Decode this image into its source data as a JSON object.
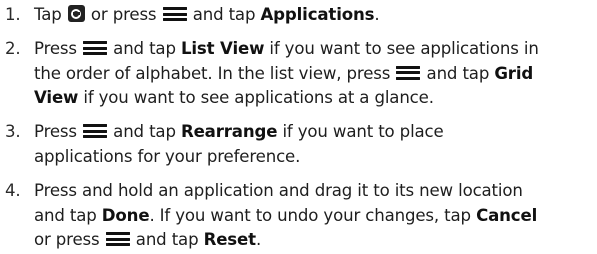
{
  "steps": [
    {
      "number": "1.",
      "t1": "Tap",
      "t2": "or press",
      "t3": "and tap",
      "b1": "Applications",
      "t4": "."
    },
    {
      "number": "2.",
      "l1": {
        "t1": "Press",
        "t2": "and tap",
        "b1": "List View",
        "t3": "if you want to see applications in"
      },
      "l2": {
        "t1": "the order of alphabet. In the list view, press",
        "t2": "and tap",
        "b1": "Grid"
      },
      "l3": {
        "b1": "View",
        "t1": "if you want to see applications at a glance."
      }
    },
    {
      "number": "3.",
      "l1": {
        "t1": "Press",
        "t2": "and tap",
        "b1": "Rearrange",
        "t3": "if you want to place"
      },
      "l2": {
        "t1": "applications for your preference."
      }
    },
    {
      "number": "4.",
      "l1": {
        "t1": "Press and hold an application and drag it to its new location"
      },
      "l2": {
        "t1": "and tap",
        "b1": "Done",
        "t2": ". If you want to undo your changes, tap",
        "b2": "Cancel"
      },
      "l3": {
        "t1": "or press",
        "t2": "and tap",
        "b1": "Reset",
        "t3": "."
      }
    }
  ],
  "icons": {
    "home": "home-key-icon",
    "menu": "menu-key-icon"
  }
}
